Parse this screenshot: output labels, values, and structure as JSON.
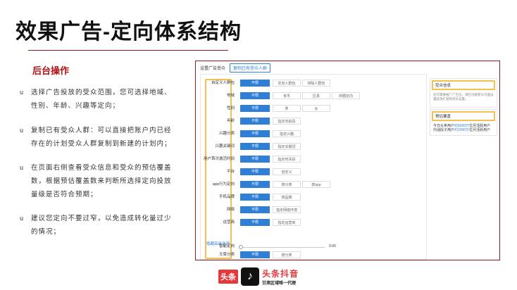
{
  "slide": {
    "title": "效果广告-定向体系结构",
    "subtitle": "后台操作",
    "bullet_marker": "u",
    "bullets": [
      "选择广告投放的受众范围，您可选择地域、性别、年龄、兴趣等定向；",
      "复制已有受众人群：可以直接把账户内已经存在的计划受众人群复制到新建的计划内；",
      "在页面右侧查看受众信息和受众的预估覆盖数，根据预估覆盖数来判断所选择定向投放量级是否符合预期；",
      "建议您定向不要过窄，以免造成转化量过少的情况；"
    ]
  },
  "screenshot": {
    "header_title": "设置广告受众",
    "copy_button": "复制已有受众人群",
    "rows": [
      {
        "label": "自定义人群包",
        "selected": "不限",
        "options": [
          "定向人群包",
          "排除人群包"
        ]
      },
      {
        "label": "地域",
        "selected": "不限",
        "options": [
          "省市",
          "区县",
          "商圈定向"
        ]
      },
      {
        "label": "性别",
        "selected": "不限",
        "options": [
          "男",
          "女"
        ]
      },
      {
        "label": "年龄",
        "selected": "不限",
        "options": [
          "指定年龄段"
        ]
      },
      {
        "label": "兴趣分类",
        "selected": "不限",
        "options": [
          "指定兴趣"
        ]
      },
      {
        "label": "兴趣关键词",
        "selected": "不限",
        "options": [
          "指定关键词"
        ]
      },
      {
        "label": "用户首次激活时间",
        "selected": "不限",
        "options": [
          "指定时间段"
        ]
      },
      {
        "label": "平台",
        "selected": "不限",
        "options": [
          "自定义"
        ]
      },
      {
        "label": "app行为定向",
        "selected": "不限",
        "options": [
          "按分类",
          "按app"
        ]
      },
      {
        "label": "手机品牌",
        "selected": "不限",
        "options": [
          "按品牌"
        ]
      },
      {
        "label": "网络",
        "selected": "不限",
        "options": [
          "指定网络环境"
        ]
      },
      {
        "label": "运营商",
        "selected": "不限",
        "options": [
          "指定运营商"
        ]
      }
    ],
    "advanced_link": "隐藏高级选项",
    "smart_label": "智能定向",
    "smart_value": "0.00",
    "text_category_label": "文章分类",
    "text_category_selected": "不限",
    "text_category_option": "按分类",
    "side_audience_title": "受众信息",
    "side_audience_text": "您可需要推广广告位，请在创建受众页面设置投放扩展等优化设置。",
    "side_estimate_title": "预估覆盖",
    "side_estimate_prefix": "今日头条用户",
    "side_estimate_value1": "约5000万",
    "side_estimate_mid": "位月活跃用户",
    "side_estimate_prefix2": "内涵段子用户",
    "side_estimate_value2": "约2000万",
    "side_estimate_suffix": "位月活跃用户"
  },
  "logo": {
    "toutiao": "头条",
    "tiktok_glyph": "♪",
    "brand_name": "头条抖音",
    "brand_tag": "甘肃区域唯一代理"
  },
  "colors": {
    "accent_red": "#b01414",
    "rule": "#8a1c1c",
    "selected_blue": "#2f7fd8",
    "highlight_yellow": "#f2c14e"
  }
}
